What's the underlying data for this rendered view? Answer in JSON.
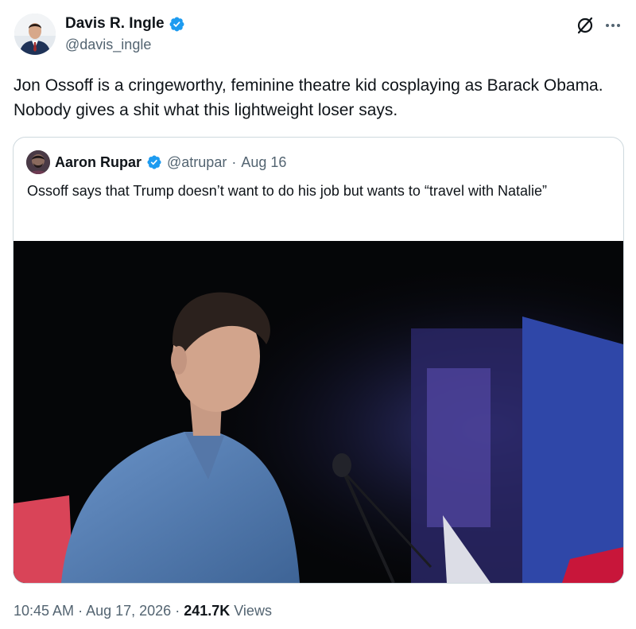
{
  "author": {
    "name": "Davis R. Ingle",
    "handle": "@davis_ingle",
    "verified": true
  },
  "tweet": {
    "text": "Jon Ossoff is a cringeworthy, feminine theatre kid cosplaying as Barack Obama. Nobody gives a shit what this lightweight loser says."
  },
  "quote": {
    "author_name": "Aaron Rupar",
    "handle": "@atrupar",
    "separator": "·",
    "date": "Aug 16",
    "verified": true,
    "text": "Ossoff says that Trump doesn’t want to do his job but wants to “travel with Natalie”"
  },
  "meta": {
    "time": "10:45 AM",
    "separator1": " · ",
    "date": "Aug 17, 2026",
    "separator2": " · ",
    "views_count": "241.7K",
    "views_label": "Views"
  },
  "colors": {
    "verified_blue": "#1d9bf0",
    "secondary_text": "#536471",
    "border": "#cfd9de"
  },
  "icons": [
    "verified-badge-icon",
    "grok-icon",
    "more-icon"
  ]
}
